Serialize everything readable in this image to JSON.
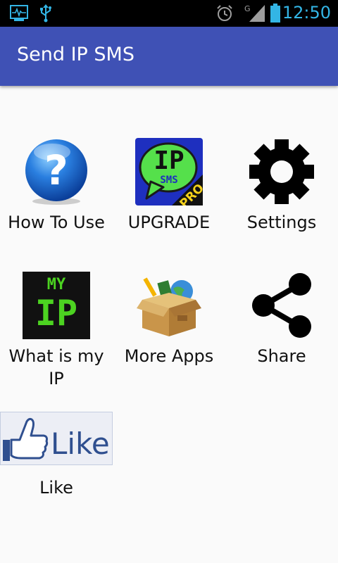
{
  "status_bar": {
    "time": "12:50",
    "icons": [
      "activity-monitor-icon",
      "usb-icon",
      "alarm-icon",
      "signal-g-icon",
      "battery-icon"
    ],
    "network_type": "G"
  },
  "app_bar": {
    "title": "Send IP SMS",
    "color": "#3f51b5"
  },
  "grid": {
    "items": [
      {
        "label": "How To Use",
        "icon": "help-question-icon"
      },
      {
        "label": "UPGRADE",
        "icon": "ip-sms-pro-icon",
        "icon_text_top": "IP",
        "icon_text_bottom": "SMS",
        "icon_badge": "PRO"
      },
      {
        "label": "Settings",
        "icon": "gear-icon"
      },
      {
        "label": "What is my IP",
        "icon": "my-ip-icon",
        "icon_text_top": "MY",
        "icon_text_bottom": "IP"
      },
      {
        "label": "More Apps",
        "icon": "box-apps-icon"
      },
      {
        "label": "Share",
        "icon": "share-icon"
      },
      {
        "label": "Like",
        "icon": "facebook-like-icon",
        "icon_text": "Like"
      }
    ]
  }
}
